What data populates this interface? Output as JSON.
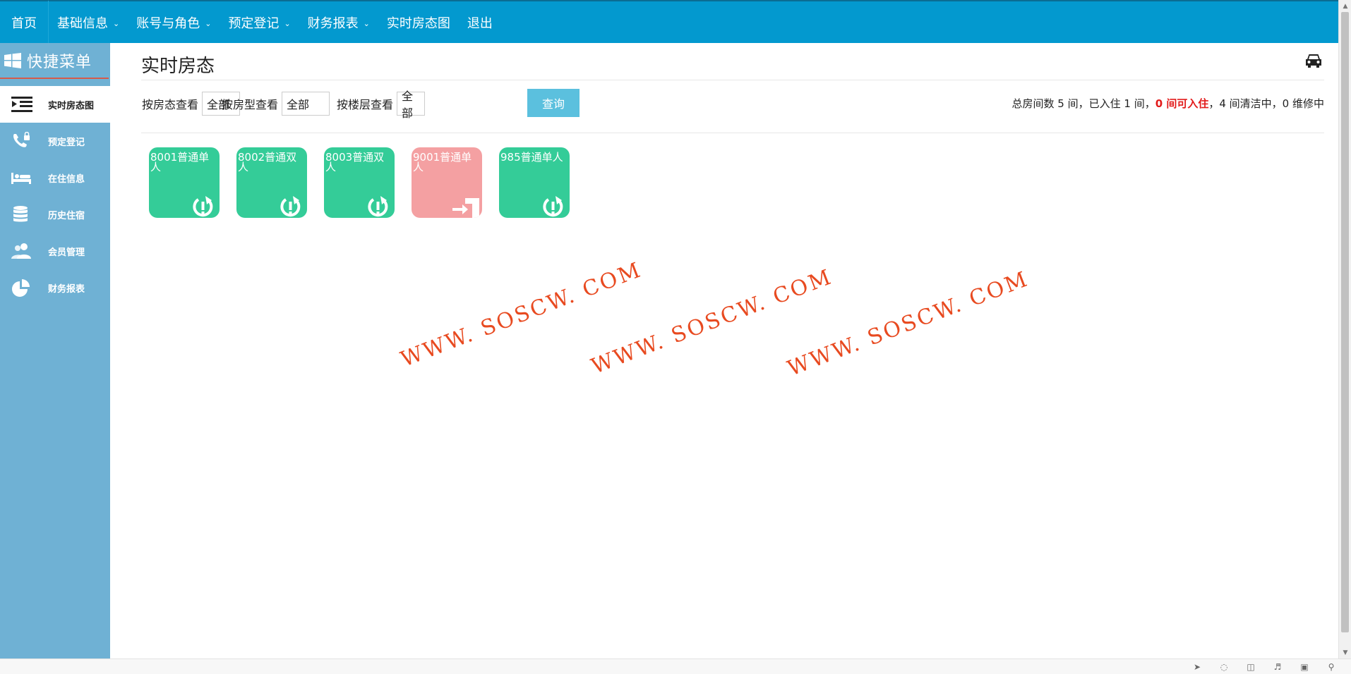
{
  "nav": {
    "items": [
      {
        "label": "首页",
        "dropdown": false
      },
      {
        "label": "基础信息",
        "dropdown": true
      },
      {
        "label": "账号与角色",
        "dropdown": true
      },
      {
        "label": "预定登记",
        "dropdown": true
      },
      {
        "label": "财务报表",
        "dropdown": true
      },
      {
        "label": "实时房态图",
        "dropdown": false
      },
      {
        "label": "退出",
        "dropdown": false
      }
    ],
    "color": "#0399cf"
  },
  "sidebar": {
    "title": "快捷菜单",
    "items": [
      {
        "label": "实时房态图",
        "icon": "list-indent-icon",
        "active": true
      },
      {
        "label": "预定登记",
        "icon": "phone-icon",
        "active": false
      },
      {
        "label": "在住信息",
        "icon": "bed-icon",
        "active": false
      },
      {
        "label": "历史住宿",
        "icon": "database-icon",
        "active": false
      },
      {
        "label": "会员管理",
        "icon": "users-icon",
        "active": false
      },
      {
        "label": "财务报表",
        "icon": "pie-chart-icon",
        "active": false
      }
    ],
    "color": "#6fb1d4"
  },
  "page": {
    "title": "实时房态",
    "header_icon": "car-icon"
  },
  "filters": {
    "status": {
      "label": "按房态查看",
      "value": "全部"
    },
    "type": {
      "label": "按房型查看",
      "value": "全部"
    },
    "floor": {
      "label": "按楼层查看",
      "value": "全部"
    },
    "query_button": "查询"
  },
  "summary": {
    "total": "总房间数 5 间，已入住 1 间，",
    "available": "0 间可入住",
    "rest": "，4 间清洁中，0 维修中"
  },
  "rooms": [
    {
      "name": "8001普通单人",
      "status": "cleaning",
      "icon": "refresh-alert-icon",
      "color": "#34cc98"
    },
    {
      "name": "8002普通双人",
      "status": "cleaning",
      "icon": "refresh-alert-icon",
      "color": "#34cc98"
    },
    {
      "name": "8003普通双人",
      "status": "cleaning",
      "icon": "refresh-alert-icon",
      "color": "#34cc98"
    },
    {
      "name": "9001普通单人",
      "status": "occupied",
      "icon": "check-in-icon",
      "color": "#f4a0a2"
    },
    {
      "name": "985普通单人",
      "status": "cleaning",
      "icon": "refresh-alert-icon",
      "color": "#34cc98"
    }
  ],
  "watermark": {
    "text": "WWW. SOSCW. COM"
  }
}
